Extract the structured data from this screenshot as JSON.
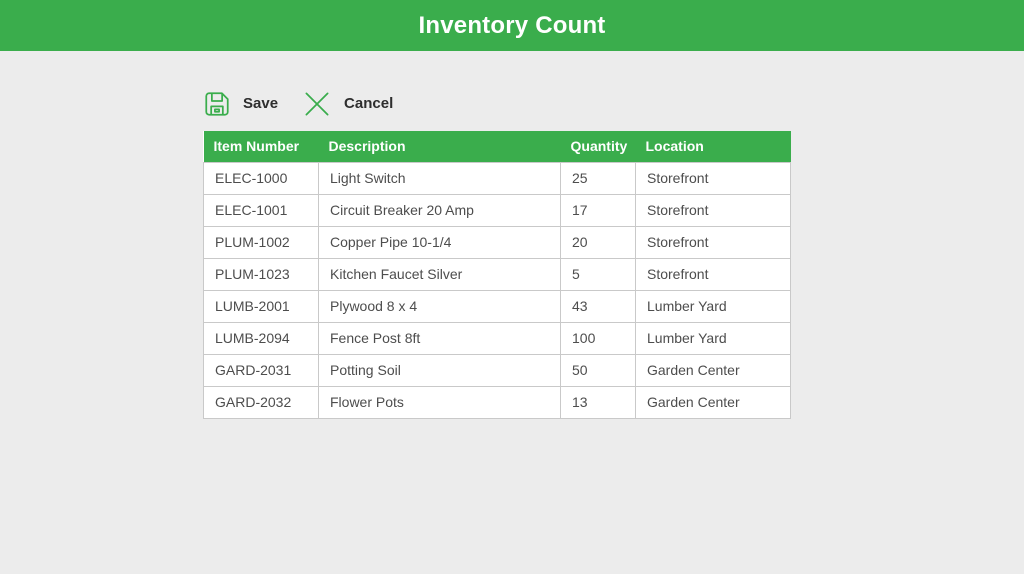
{
  "header": {
    "title": "Inventory Count"
  },
  "toolbar": {
    "save_label": "Save",
    "cancel_label": "Cancel"
  },
  "table": {
    "columns": [
      "Item Number",
      "Description",
      "Quantity",
      "Location"
    ],
    "rows": [
      {
        "item_number": "ELEC-1000",
        "description": "Light Switch",
        "quantity": "25",
        "location": "Storefront"
      },
      {
        "item_number": "ELEC-1001",
        "description": "Circuit Breaker 20 Amp",
        "quantity": "17",
        "location": "Storefront"
      },
      {
        "item_number": "PLUM-1002",
        "description": "Copper Pipe 10-1/4",
        "quantity": "20",
        "location": "Storefront"
      },
      {
        "item_number": "PLUM-1023",
        "description": "Kitchen Faucet Silver",
        "quantity": "5",
        "location": "Storefront"
      },
      {
        "item_number": "LUMB-2001",
        "description": "Plywood 8 x 4",
        "quantity": "43",
        "location": "Lumber Yard"
      },
      {
        "item_number": "LUMB-2094",
        "description": "Fence Post 8ft",
        "quantity": "100",
        "location": "Lumber Yard"
      },
      {
        "item_number": "GARD-2031",
        "description": "Potting Soil",
        "quantity": "50",
        "location": "Garden Center"
      },
      {
        "item_number": "GARD-2032",
        "description": "Flower Pots",
        "quantity": "13",
        "location": "Garden Center"
      }
    ]
  },
  "colors": {
    "accent_green": "#3aad4c",
    "page_background": "#ececec",
    "table_border": "#c9c9c9",
    "header_text": "#ffffff",
    "cell_text": "#4d4d4d"
  }
}
